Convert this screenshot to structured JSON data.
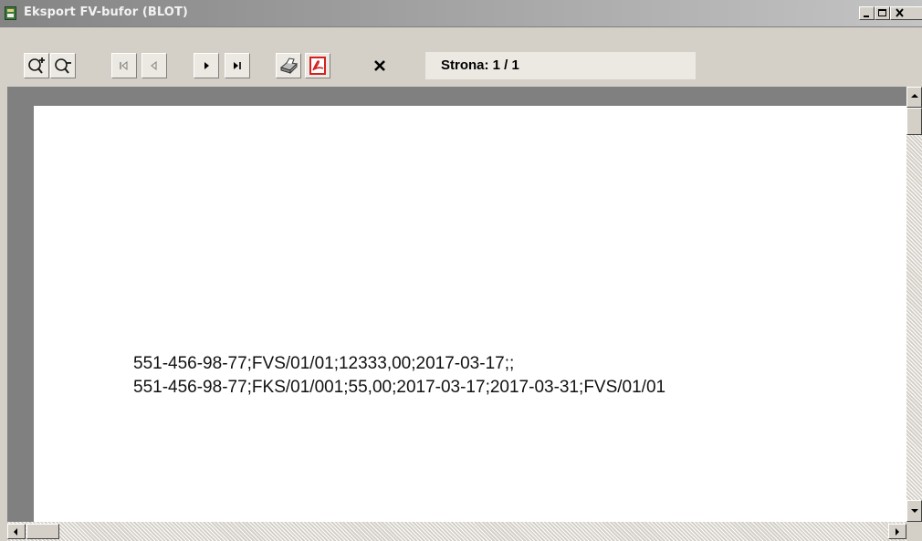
{
  "window": {
    "title": "Eksport FV-bufor (BLOT)"
  },
  "toolbar": {
    "buttons": [
      {
        "name": "zoom-in",
        "icon": "zoom-in-icon"
      },
      {
        "name": "zoom-out",
        "icon": "zoom-out-icon"
      },
      {
        "name": "first-page",
        "icon": "first-page-icon"
      },
      {
        "name": "prev-page",
        "icon": "prev-page-icon"
      },
      {
        "name": "next-page",
        "icon": "next-page-icon"
      },
      {
        "name": "last-page",
        "icon": "last-page-icon"
      },
      {
        "name": "print",
        "icon": "printer-icon"
      },
      {
        "name": "export-pdf",
        "icon": "pdf-icon"
      },
      {
        "name": "close-preview",
        "icon": "close-icon"
      }
    ],
    "page_info": "Strona: 1 / 1"
  },
  "document": {
    "lines": [
      "551-456-98-77;FVS/01/01;12333,00;2017-03-17;;",
      "551-456-98-77;FKS/01/001;55,00;2017-03-17;2017-03-31;FVS/01/01"
    ]
  },
  "colors": {
    "pdf_red": "#d42020",
    "preview_background": "#808080",
    "paper": "#ffffff"
  }
}
